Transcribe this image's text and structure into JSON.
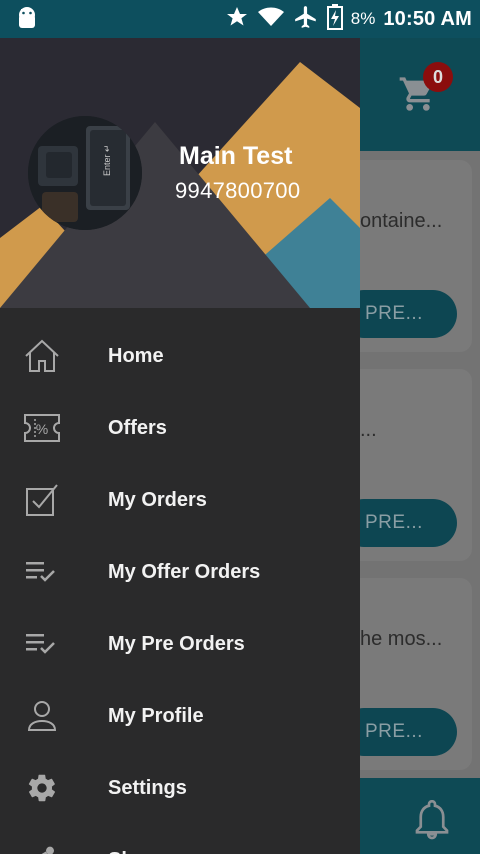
{
  "status_bar": {
    "battery_percent": "8%",
    "time": "10:50 AM",
    "icons": [
      "android-icon",
      "star-icon",
      "wifi-icon",
      "airplane-icon",
      "battery-charging-icon"
    ]
  },
  "app": {
    "cart_count": "0",
    "cards": [
      {
        "text": "ontaine...",
        "button": "PRE..."
      },
      {
        "text": "...",
        "button": "PRE..."
      },
      {
        "text": "he mos...",
        "button": "PRE..."
      }
    ]
  },
  "drawer": {
    "user": {
      "name": "Main Test",
      "phone": "9947800700"
    },
    "menu": [
      {
        "label": "Home",
        "icon": "home-icon"
      },
      {
        "label": "Offers",
        "icon": "offer-ticket-icon"
      },
      {
        "label": "My Orders",
        "icon": "checkbox-icon"
      },
      {
        "label": "My Offer Orders",
        "icon": "playlist-check-icon"
      },
      {
        "label": "My Pre Orders",
        "icon": "playlist-check-icon"
      },
      {
        "label": "My Profile",
        "icon": "person-icon"
      },
      {
        "label": "Settings",
        "icon": "gear-icon"
      },
      {
        "label": "Share",
        "icon": "share-icon"
      }
    ]
  },
  "colors": {
    "drawer_bg": "#2a2a2b",
    "header_orange": "#d09a4c",
    "header_teal": "#3f8196",
    "appbar": "#0e4a55"
  }
}
